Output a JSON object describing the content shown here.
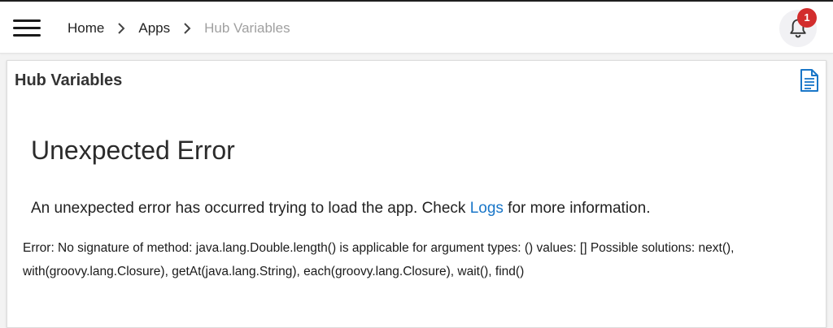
{
  "breadcrumb": {
    "home": "Home",
    "apps": "Apps",
    "current": "Hub Variables"
  },
  "notifications": {
    "count": "1",
    "icon": "bell-icon"
  },
  "card": {
    "title": "Hub Variables",
    "doc_icon": "document-icon"
  },
  "error": {
    "heading": "Unexpected Error",
    "message_before": "An unexpected error has occurred trying to load the app. Check ",
    "logs_link": "Logs",
    "message_after": " for more information.",
    "detail": "Error: No signature of method: java.lang.Double.length() is applicable for argument types: () values: [] Possible solutions: next(), with(groovy.lang.Closure), getAt(java.lang.String), each(groovy.lang.Closure), wait(), find()"
  },
  "colors": {
    "link": "#1976c8",
    "badge": "#d22d2d",
    "breadcrumb_current": "#a0a0a0"
  }
}
